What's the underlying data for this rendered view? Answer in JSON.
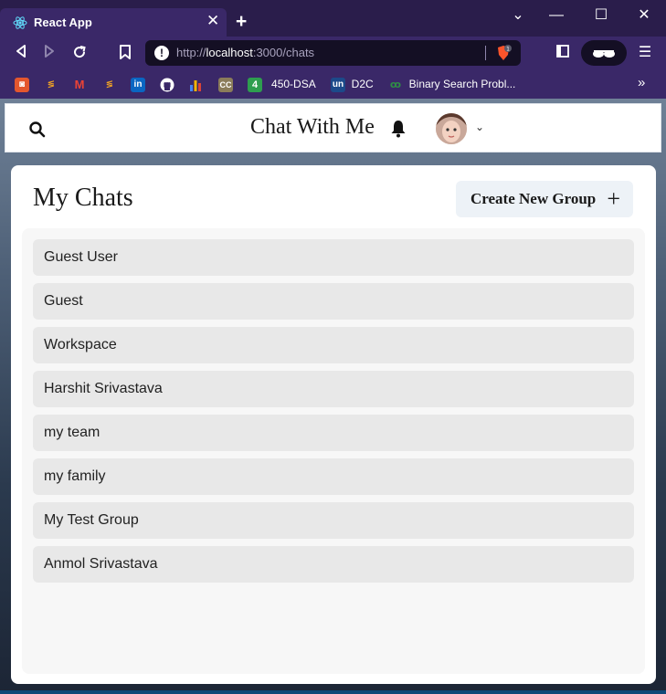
{
  "browser": {
    "tab_title": "React App",
    "tab_close": "✕",
    "new_tab": "+",
    "url_prefix": "http://",
    "url_host": "localhost",
    "url_rest": ":3000/chats",
    "brave_count": "1",
    "window_controls": {
      "collapse": "⌄",
      "minimize": "—",
      "maximize": "☐",
      "close": "✕"
    }
  },
  "bookmarks": [
    {
      "label": "",
      "icon": "red-bookmark-icon",
      "color": "#e4572e"
    },
    {
      "label": "",
      "icon": "code-bookmark-icon",
      "color": "#f5a623"
    },
    {
      "label": "",
      "icon": "gmail-icon",
      "color": "#ea4335"
    },
    {
      "label": "",
      "icon": "code-bookmark-icon-2",
      "color": "#f5a623"
    },
    {
      "label": "",
      "icon": "linkedin-icon",
      "color": "#0a66c2"
    },
    {
      "label": "",
      "icon": "github-icon",
      "color": "#ffffff"
    },
    {
      "label": "",
      "icon": "chart-bookmark-icon",
      "color": "#f4b400"
    },
    {
      "label": "",
      "icon": "cc-icon",
      "color": "#8b7c5a"
    },
    {
      "label": "450-DSA",
      "icon": "four-icon",
      "color": "#2e9e4f"
    },
    {
      "label": "D2C",
      "icon": "unstop-icon",
      "color": "#1c4a8a"
    },
    {
      "label": "Binary Search Probl...",
      "icon": "gfg-icon",
      "color": "#2f8d46"
    }
  ],
  "bookmarks_more": "»",
  "header": {
    "app_title": "Chat With Me"
  },
  "panel": {
    "title": "My Chats",
    "create_group_label": "Create New Group",
    "create_group_icon": "+"
  },
  "chats": [
    "Guest User",
    "Guest",
    "Workspace",
    "Harshit Srivastava",
    "my team",
    "my family",
    "My Test Group",
    "Anmol Srivastava"
  ],
  "colors": {
    "browser_chrome": "#3a2868",
    "titlebar": "#2a1d4b",
    "panel_bg": "#ffffff",
    "list_bg": "#f7f7f7",
    "chat_item_bg": "#e8e8e8",
    "button_bg": "#edf2f7"
  }
}
